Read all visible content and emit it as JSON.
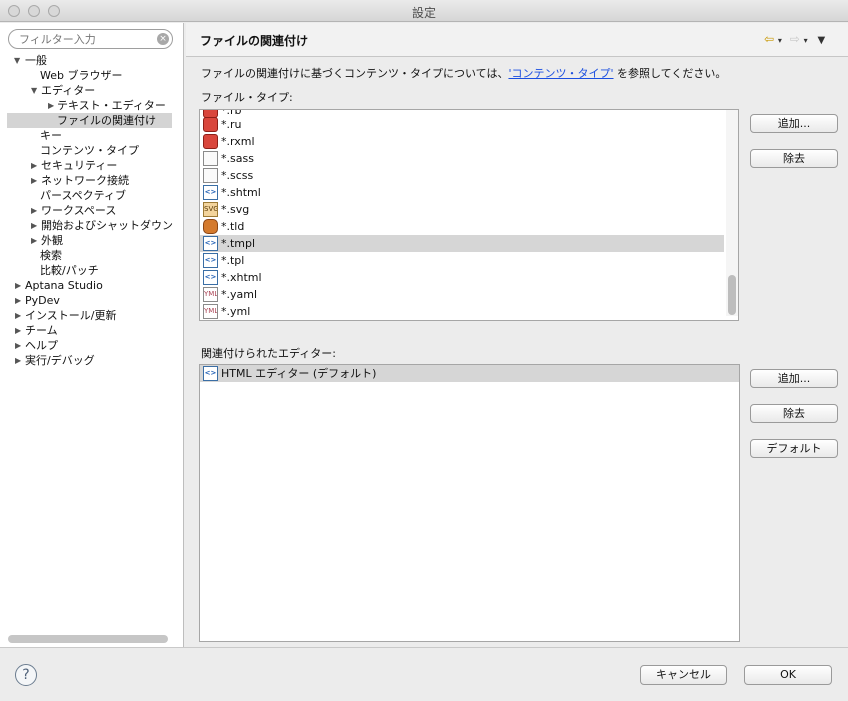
{
  "window": {
    "title": "設定"
  },
  "sidebar": {
    "filter_placeholder": "フィルター入力",
    "clear_glyph": "×",
    "items": [
      {
        "label": "一般",
        "arrow": "▼"
      },
      {
        "label": "Web ブラウザー",
        "arrow": ""
      },
      {
        "label": "エディター",
        "arrow": "▼"
      },
      {
        "label": "テキスト・エディター",
        "arrow": "▶"
      },
      {
        "label": "ファイルの関連付け",
        "arrow": ""
      },
      {
        "label": "キー",
        "arrow": ""
      },
      {
        "label": "コンテンツ・タイプ",
        "arrow": ""
      },
      {
        "label": "セキュリティー",
        "arrow": "▶"
      },
      {
        "label": "ネットワーク接続",
        "arrow": "▶"
      },
      {
        "label": "パースペクティブ",
        "arrow": ""
      },
      {
        "label": "ワークスペース",
        "arrow": "▶"
      },
      {
        "label": "開始およびシャットダウン",
        "arrow": "▶"
      },
      {
        "label": "外観",
        "arrow": "▶"
      },
      {
        "label": "検索",
        "arrow": ""
      },
      {
        "label": "比較/パッチ",
        "arrow": ""
      },
      {
        "label": "Aptana Studio",
        "arrow": "▶"
      },
      {
        "label": "PyDev",
        "arrow": "▶"
      },
      {
        "label": "インストール/更新",
        "arrow": "▶"
      },
      {
        "label": "チーム",
        "arrow": "▶"
      },
      {
        "label": "ヘルプ",
        "arrow": "▶"
      },
      {
        "label": "実行/デバッグ",
        "arrow": "▶"
      }
    ]
  },
  "main": {
    "title": "ファイルの関連付け",
    "nav": {
      "back": "⇦",
      "forward": "⇨",
      "dropdown": "▾",
      "menu": "▼"
    },
    "description_prefix": "ファイルの関連付けに基づくコンテンツ・タイプについては、",
    "description_link": "'コンテンツ・タイプ'",
    "description_suffix": " を参照してください。",
    "file_types_label": "ファイル・タイプ:",
    "file_types": [
      {
        "label": "*.rb",
        "icon": "ruby-file-icon"
      },
      {
        "label": "*.ru",
        "icon": "ruby-file-icon"
      },
      {
        "label": "*.rxml",
        "icon": "ruby-file-icon"
      },
      {
        "label": "*.sass",
        "icon": "css-file-icon"
      },
      {
        "label": "*.scss",
        "icon": "css-file-icon"
      },
      {
        "label": "*.shtml",
        "icon": "html-file-icon"
      },
      {
        "label": "*.svg",
        "icon": "svg-file-icon"
      },
      {
        "label": "*.tld",
        "icon": "tld-file-icon"
      },
      {
        "label": "*.tmpl",
        "icon": "html-file-icon"
      },
      {
        "label": "*.tpl",
        "icon": "html-file-icon"
      },
      {
        "label": "*.xhtml",
        "icon": "html-file-icon"
      },
      {
        "label": "*.yaml",
        "icon": "yaml-file-icon"
      },
      {
        "label": "*.yml",
        "icon": "yaml-file-icon"
      }
    ],
    "editors_label": "関連付けられたエディター:",
    "editors": [
      {
        "label": "HTML エディター (デフォルト)",
        "icon": "html-file-icon"
      }
    ],
    "buttons": {
      "add": "追加...",
      "remove": "除去",
      "default": "デフォルト"
    },
    "icon_glyphs": {
      "html": "<>",
      "svg": "SVG",
      "yaml": "YML",
      "ruby": "",
      "css": "",
      "tld": ""
    }
  },
  "footer": {
    "help": "?",
    "cancel": "キャンセル",
    "ok": "OK"
  }
}
